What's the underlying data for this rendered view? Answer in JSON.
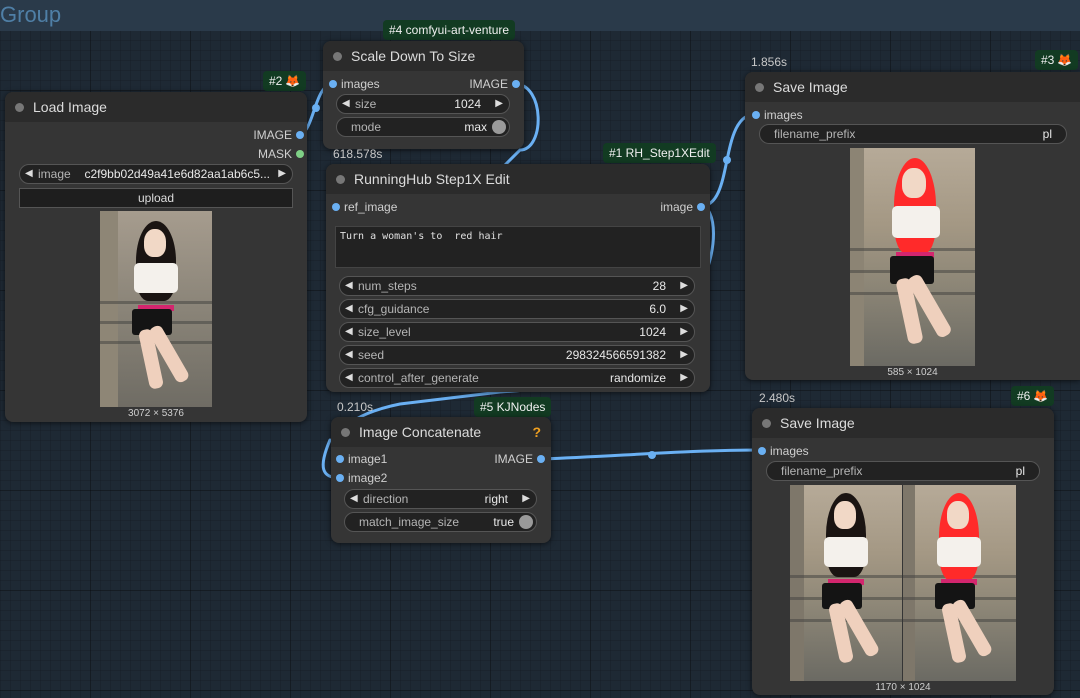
{
  "group": {
    "title": "Group"
  },
  "colors": {
    "link": "#6ab0f3",
    "mask_slot": "#7fd086",
    "badge_bg": "#123b22",
    "hair_original": "#1a1412",
    "hair_red": "#ff2a2a"
  },
  "nodes": {
    "load_image": {
      "badge": "#2",
      "badge_icon": "fox-icon",
      "title": "Load Image",
      "outputs": [
        "IMAGE",
        "MASK"
      ],
      "image_widget": {
        "label": "image",
        "value": "c2f9bb02d49a41e6d82aa1ab6c5..."
      },
      "upload_label": "upload",
      "dims": "3072 × 5376"
    },
    "scale_down": {
      "badge": "#4 comfyui-art-venture",
      "title": "Scale Down To Size",
      "input": "images",
      "output": "IMAGE",
      "size": {
        "label": "size",
        "value": "1024"
      },
      "mode": {
        "label": "mode",
        "value": "max"
      },
      "exec_time": "618.578s"
    },
    "step1x": {
      "badge": "#1 RH_Step1XEdit",
      "title": "RunningHub Step1X Edit",
      "input": "ref_image",
      "output": "image",
      "prompt": "Turn a woman's to  red hair",
      "widgets": [
        {
          "label": "num_steps",
          "value": "28"
        },
        {
          "label": "cfg_guidance",
          "value": "6.0"
        },
        {
          "label": "size_level",
          "value": "1024"
        },
        {
          "label": "seed",
          "value": "298324566591382"
        },
        {
          "label": "control_after_generate",
          "value": "randomize"
        }
      ],
      "exec_time": "0.210s"
    },
    "save_image_3": {
      "badge": "#3",
      "badge_icon": "fox-icon",
      "title": "Save Image",
      "input": "images",
      "filename_prefix": {
        "label": "filename_prefix",
        "value": "pl"
      },
      "exec_time": "1.856s",
      "dims": "585 × 1024"
    },
    "concat": {
      "badge": "#5 KJNodes",
      "title": "Image Concatenate",
      "help_icon": "?",
      "inputs": [
        "image1",
        "image2"
      ],
      "output": "IMAGE",
      "direction": {
        "label": "direction",
        "value": "right"
      },
      "match_image_size": {
        "label": "match_image_size",
        "value": "true"
      }
    },
    "save_image_6": {
      "badge": "#6",
      "badge_icon": "fox-icon",
      "title": "Save Image",
      "input": "images",
      "filename_prefix": {
        "label": "filename_prefix",
        "value": "pl"
      },
      "exec_time": "2.480s",
      "dims": "1170 × 1024"
    }
  }
}
